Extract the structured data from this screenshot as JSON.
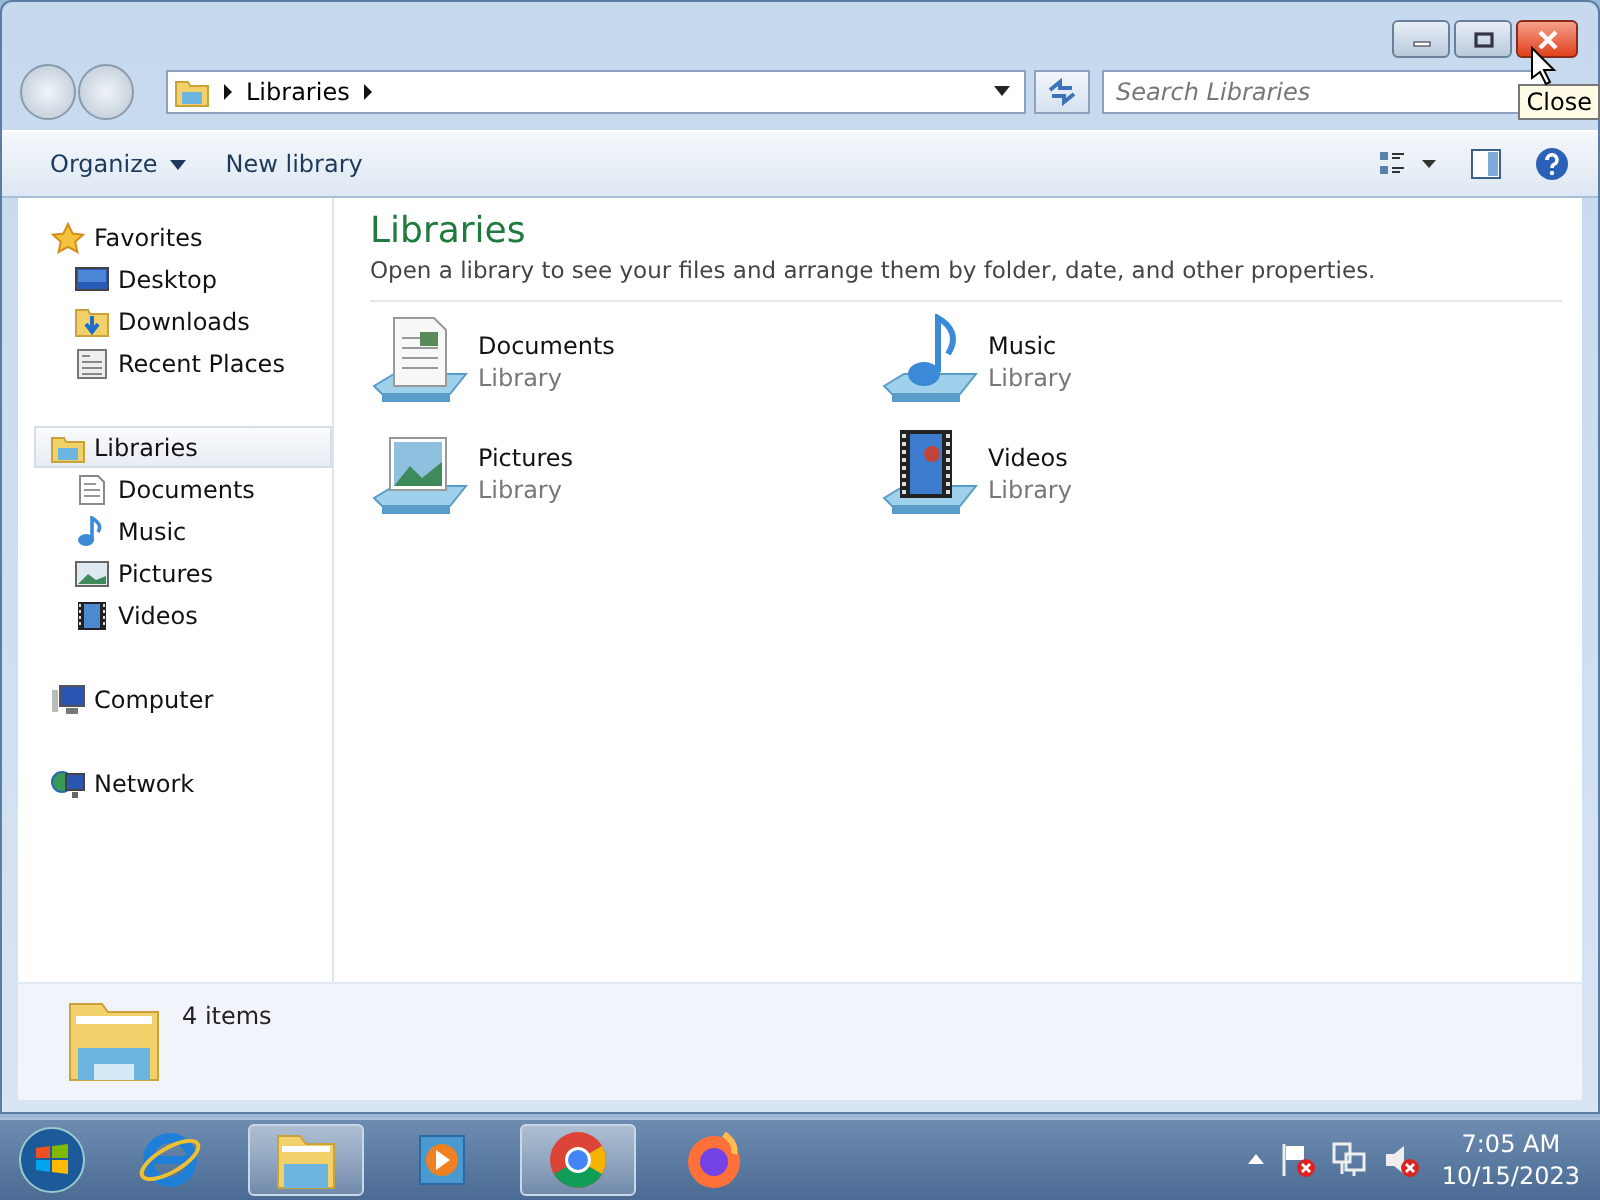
{
  "window": {
    "caption_buttons": [
      {
        "kind": "minimize",
        "hovered": false
      },
      {
        "kind": "maximize",
        "hovered": false
      },
      {
        "kind": "close",
        "hovered": true
      }
    ],
    "tooltip": "Close"
  },
  "address_bar": {
    "crumbs": [
      "Libraries"
    ]
  },
  "search": {
    "placeholder": "Search Libraries"
  },
  "toolbar": {
    "items": [
      {
        "label": "Organize",
        "dropdown": true
      },
      {
        "label": "New library",
        "dropdown": false
      }
    ]
  },
  "nav": {
    "groups": [
      {
        "label": "Favorites",
        "kind": "star",
        "selected": false,
        "children": [
          {
            "label": "Desktop",
            "kind": "desktop",
            "selected": false
          },
          {
            "label": "Downloads",
            "kind": "downloads",
            "selected": false
          },
          {
            "label": "Recent Places",
            "kind": "recent",
            "selected": false
          }
        ]
      },
      {
        "label": "Libraries",
        "kind": "libraries",
        "selected": true,
        "children": [
          {
            "label": "Documents",
            "kind": "documents",
            "selected": false
          },
          {
            "label": "Music",
            "kind": "music",
            "selected": false
          },
          {
            "label": "Pictures",
            "kind": "pictures",
            "selected": false
          },
          {
            "label": "Videos",
            "kind": "videos",
            "selected": false
          }
        ]
      },
      {
        "label": "Computer",
        "kind": "computer",
        "selected": false
      },
      {
        "label": "Network",
        "kind": "network",
        "selected": false
      }
    ]
  },
  "content": {
    "title": "Libraries",
    "subtitle": "Open a library to see your files and arrange them by folder, date, and other properties.",
    "items": [
      {
        "name": "Documents",
        "type": "Library",
        "kind": "documents"
      },
      {
        "name": "Music",
        "type": "Library",
        "kind": "music"
      },
      {
        "name": "Pictures",
        "type": "Library",
        "kind": "pictures"
      },
      {
        "name": "Videos",
        "type": "Library",
        "kind": "videos"
      }
    ]
  },
  "details": {
    "text": "4 items"
  },
  "taskbar": {
    "apps": [
      {
        "kind": "ie",
        "running": false
      },
      {
        "kind": "explorer",
        "running": true
      },
      {
        "kind": "media",
        "running": false
      },
      {
        "kind": "chrome",
        "running": true
      },
      {
        "kind": "firefox",
        "running": false
      }
    ],
    "tray": [
      {
        "kind": "flag"
      },
      {
        "kind": "network"
      },
      {
        "kind": "volume"
      }
    ],
    "clock": {
      "time": "7:05 AM",
      "date": "10/15/2023"
    }
  }
}
